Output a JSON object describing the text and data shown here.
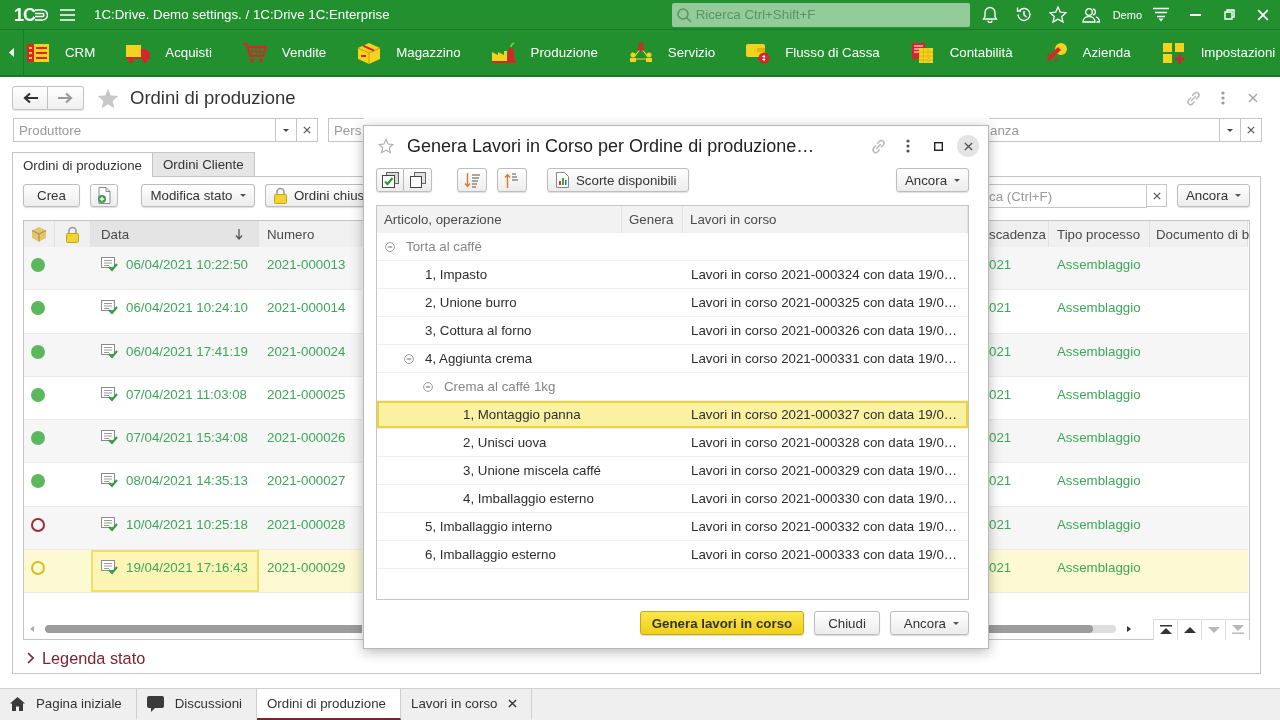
{
  "top_bar": {
    "logo": "1C",
    "title": "1C:Drive. Demo settings. / 1C:Drive 1C:Enterprise",
    "search": {
      "placeholder": "Ricerca Ctrl+Shift+F"
    },
    "user": "Demo"
  },
  "sections": [
    {
      "label": "CRM",
      "kind": "crm"
    },
    {
      "label": "Acquisti",
      "kind": "purchases"
    },
    {
      "label": "Vendite",
      "kind": "sales"
    },
    {
      "label": "Magazzino",
      "kind": "warehouse"
    },
    {
      "label": "Produzione",
      "kind": "production"
    },
    {
      "label": "Servizio",
      "kind": "service"
    },
    {
      "label": "Flusso di Cassa",
      "kind": "cash_flow"
    },
    {
      "label": "Contabilità",
      "kind": "accounting"
    },
    {
      "label": "Azienda",
      "kind": "company"
    },
    {
      "label": "Impostazioni",
      "kind": "settings"
    }
  ],
  "form": {
    "title": "Ordini di produzione",
    "filters": [
      {
        "placeholder": "Produttore",
        "kind": "full"
      },
      {
        "placeholder": "Pers",
        "kind": "cut_right"
      },
      {
        "placeholder": "anza",
        "kind": "cut_left"
      }
    ],
    "tabs": [
      {
        "label": "Ordini di produzione",
        "selected": true
      },
      {
        "label": "Ordini Cliente",
        "selected": false
      }
    ],
    "toolbar": {
      "create": "Crea",
      "change_status": "Modifica stato",
      "closed_orders": "Ordini chius",
      "search": {
        "placeholder": "ca (Ctrl+F)"
      },
      "more": "Ancora"
    },
    "table": {
      "columns": [
        {
          "label": "Data",
          "sorted": true
        },
        {
          "label": "Numero",
          "sorted": false
        },
        {
          "label": "scadenza",
          "sorted": false
        },
        {
          "label": "Tipo processo",
          "sorted": false
        },
        {
          "label": "Documento di b",
          "sorted": false
        }
      ],
      "rows": [
        {
          "status": {
            "color": "#5cb85c",
            "filled": true
          },
          "date": "06/04/2021 10:22:50",
          "number": "2021-000013",
          "deadline": "021",
          "process": "Assemblaggio",
          "selected": false
        },
        {
          "status": {
            "color": "#5cb85c",
            "filled": true
          },
          "date": "06/04/2021 10:24:10",
          "number": "2021-000014",
          "deadline": "021",
          "process": "Assemblaggio",
          "selected": false
        },
        {
          "status": {
            "color": "#5cb85c",
            "filled": true
          },
          "date": "06/04/2021 17:41:19",
          "number": "2021-000024",
          "deadline": "021",
          "process": "Assemblaggio",
          "selected": false
        },
        {
          "status": {
            "color": "#5cb85c",
            "filled": true
          },
          "date": "07/04/2021 11:03:08",
          "number": "2021-000025",
          "deadline": "021",
          "process": "Assemblaggio",
          "selected": false
        },
        {
          "status": {
            "color": "#5cb85c",
            "filled": true
          },
          "date": "07/04/2021 15:34:08",
          "number": "2021-000026",
          "deadline": "021",
          "process": "Assemblaggio",
          "selected": false
        },
        {
          "status": {
            "color": "#5cb85c",
            "filled": true
          },
          "date": "08/04/2021 14:35:13",
          "number": "2021-000027",
          "deadline": "021",
          "process": "Assemblaggio",
          "selected": false
        },
        {
          "status": {
            "color": "#9b2d33",
            "filled": false
          },
          "date": "10/04/2021 10:25:18",
          "number": "2021-000028",
          "deadline": "021",
          "process": "Assemblaggio",
          "selected": false
        },
        {
          "status": {
            "color": "#d6bd1c",
            "filled": false
          },
          "date": "19/04/2021 17:16:43",
          "number": "2021-000029",
          "deadline": "021",
          "process": "Assemblaggio",
          "selected": true
        }
      ],
      "nav_buttons": [
        {
          "kind": "first",
          "disabled": false
        },
        {
          "kind": "up",
          "disabled": false
        },
        {
          "kind": "down",
          "disabled": true
        },
        {
          "kind": "last",
          "disabled": true
        }
      ]
    },
    "legend": {
      "label": "Legenda stato",
      "expanded": false
    }
  },
  "taskbar": [
    {
      "label": "Pagina iniziale",
      "kind": "home",
      "selected": false,
      "closable": false
    },
    {
      "label": "Discussioni",
      "kind": "discussions",
      "selected": false,
      "closable": false
    },
    {
      "label": "Ordini di produzione",
      "kind": "document",
      "selected": true,
      "closable": false
    },
    {
      "label": "Lavori in corso",
      "kind": "document",
      "selected": false,
      "closable": true
    }
  ],
  "dialog": {
    "title": "Genera Lavori in Corso per Ordine di produzione…",
    "toolbar": {
      "stock": "Scorte disponibili",
      "more": "Ancora"
    },
    "columns": [
      "Articolo, operazione",
      "Genera",
      "Lavori in corso"
    ],
    "tree": [
      {
        "label": "Torta al caffé",
        "kind": "product",
        "expanded": true,
        "selected": false,
        "children": [
          {
            "label": "1, Impasto",
            "kind": "operation",
            "work_order": "Lavori in corso 2021-000324 con data 19/0…",
            "selected": false
          },
          {
            "label": "2, Unione burro",
            "kind": "operation",
            "work_order": "Lavori in corso 2021-000325 con data 19/0…",
            "selected": false
          },
          {
            "label": "3, Cottura al forno",
            "kind": "operation",
            "work_order": "Lavori in corso 2021-000326 con data 19/0…",
            "selected": false
          },
          {
            "label": "4, Aggiunta crema",
            "kind": "operation",
            "work_order": "Lavori in corso 2021-000331 con data 19/0…",
            "expanded": true,
            "selected": false,
            "children": [
              {
                "label": "Crema al caffé 1kg",
                "kind": "product",
                "expanded": true,
                "selected": false,
                "children": [
                  {
                    "label": "1, Montaggio panna",
                    "kind": "operation",
                    "work_order": "Lavori in corso 2021-000327 con data 19/0…",
                    "selected": true
                  },
                  {
                    "label": "2, Unisci uova",
                    "kind": "operation",
                    "work_order": "Lavori in corso 2021-000328 con data 19/0…",
                    "selected": false
                  },
                  {
                    "label": "3, Unione miscela caffé",
                    "kind": "operation",
                    "work_order": "Lavori in corso 2021-000329 con data 19/0…",
                    "selected": false
                  },
                  {
                    "label": "4, Imballaggio esterno",
                    "kind": "operation",
                    "work_order": "Lavori in corso 2021-000330 con data 19/0…",
                    "selected": false
                  }
                ]
              }
            ]
          },
          {
            "label": "5, Imballaggio interno",
            "kind": "operation",
            "work_order": "Lavori in corso 2021-000332 con data 19/0…",
            "selected": false
          },
          {
            "label": "6, Imballaggio esterno",
            "kind": "operation",
            "work_order": "Lavori in corso 2021-000333 con data 19/0…",
            "selected": false
          }
        ]
      }
    ],
    "buttons": [
      {
        "label": "Genera lavori in corso",
        "kind": "primary"
      },
      {
        "label": "Chiudi",
        "kind": "plain"
      },
      {
        "label": "Ancora",
        "kind": "menu"
      }
    ]
  }
}
